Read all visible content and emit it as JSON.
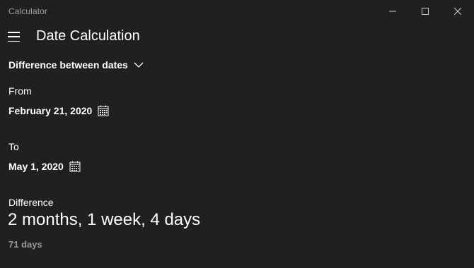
{
  "window": {
    "app_title": "Calculator"
  },
  "header": {
    "menu_icon": "hamburger-menu-icon",
    "title": "Date Calculation"
  },
  "mode": {
    "selected": "Difference between dates",
    "icon": "chevron-down-icon"
  },
  "from": {
    "label": "From",
    "value": "February 21, 2020",
    "icon": "calendar-icon"
  },
  "to": {
    "label": "To",
    "value": "May 1, 2020",
    "icon": "calendar-icon"
  },
  "difference": {
    "label": "Difference",
    "value": "2 months, 1 week, 4 days",
    "days": "71 days"
  },
  "colors": {
    "background": "#202020",
    "text": "#ffffff",
    "muted": "#9a9a9a"
  }
}
